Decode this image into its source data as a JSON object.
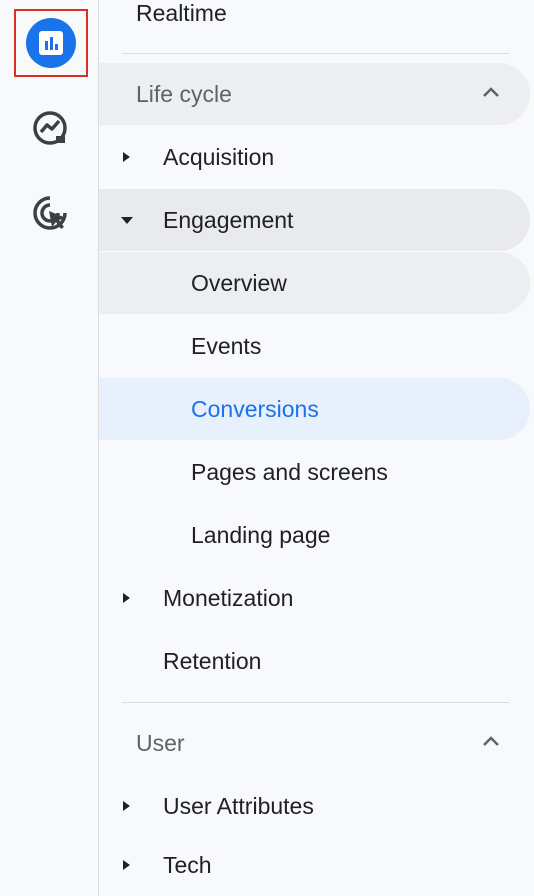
{
  "rail": {
    "items": [
      {
        "name": "reports-icon",
        "selected": true
      },
      {
        "name": "explore-icon",
        "selected": false
      },
      {
        "name": "advertising-icon",
        "selected": false
      }
    ],
    "accent": "#1a73e8",
    "highlight": "#d93025"
  },
  "nav": {
    "realtime": "Realtime",
    "lifecycle": {
      "title": "Life cycle",
      "acquisition": "Acquisition",
      "engagement": "Engagement",
      "engagement_children": [
        "Overview",
        "Events",
        "Conversions",
        "Pages and screens",
        "Landing page"
      ],
      "monetization": "Monetization",
      "retention": "Retention"
    },
    "user": {
      "title": "User",
      "user_attributes": "User Attributes",
      "tech": "Tech"
    },
    "active_item": "Conversions"
  }
}
